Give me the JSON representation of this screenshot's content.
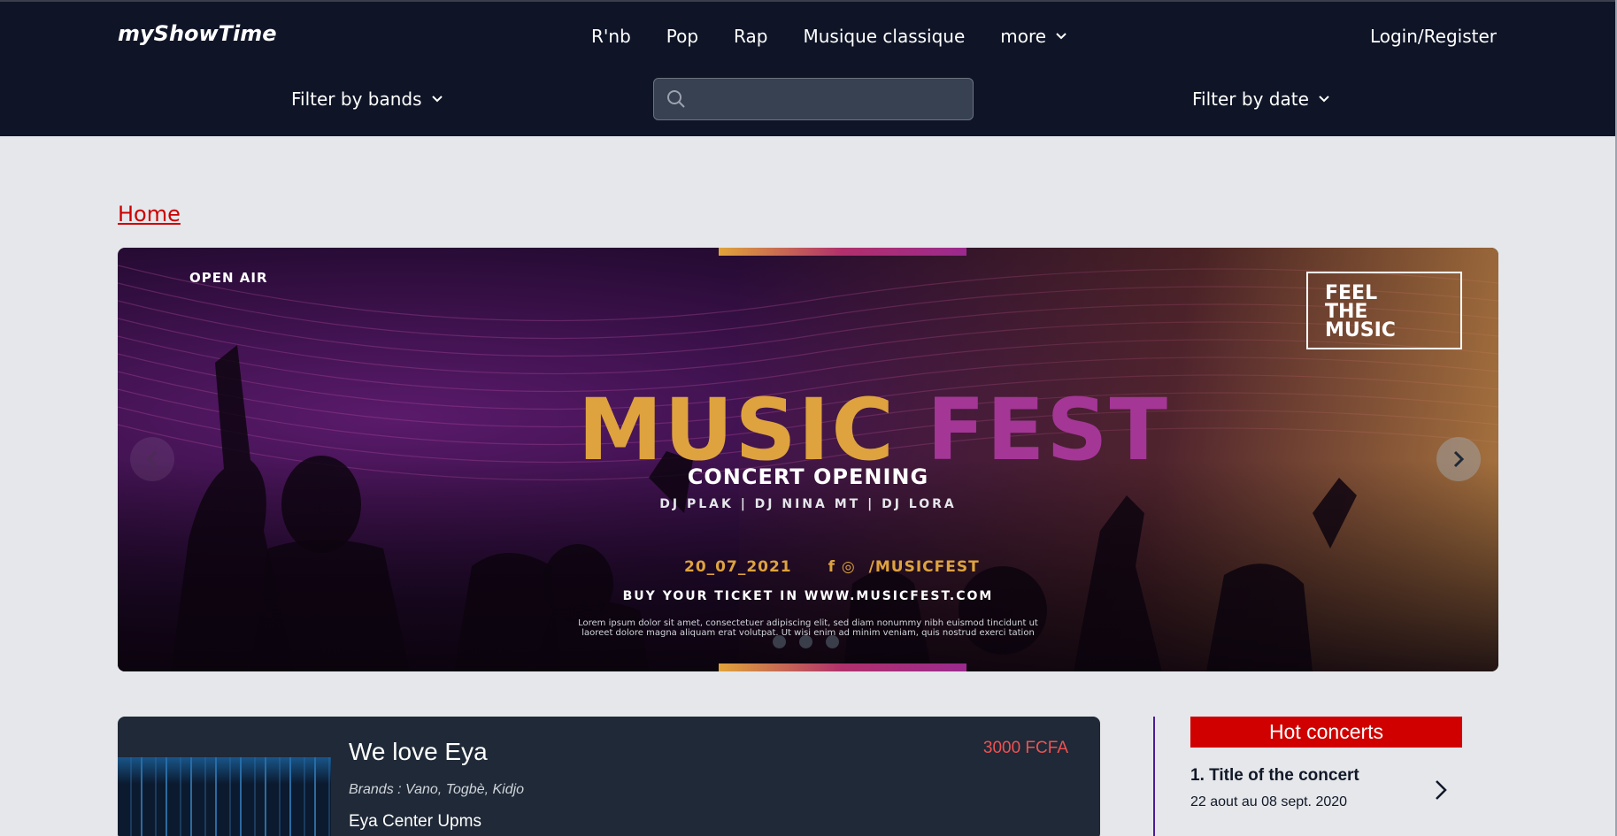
{
  "header": {
    "logo": "myShowTime",
    "nav": [
      {
        "label": "R'nb"
      },
      {
        "label": "Pop"
      },
      {
        "label": "Rap"
      },
      {
        "label": "Musique classique"
      },
      {
        "label": "more"
      }
    ],
    "login_label": "Login/Register",
    "filter_bands_label": "Filter by bands",
    "filter_date_label": "Filter by date",
    "search": {
      "placeholder": "",
      "value": ""
    }
  },
  "breadcrumb": {
    "home": "Home"
  },
  "carousel": {
    "open_air": "OPEN AIR",
    "feel_the_music": [
      "FEEL",
      "THE",
      "MUSIC"
    ],
    "title_word1": "MUSIC",
    "title_word2": "FEST",
    "subtitle": "CONCERT OPENING",
    "djs": "DJ PLAK  |  DJ NINA MT   |   DJ LORA",
    "date": "20_07_2021",
    "social_handle": "/MUSICFEST",
    "buy_text": "BUY YOUR TICKET IN WWW.MUSICFEST.COM",
    "lorem_line1": "Lorem ipsum dolor sit amet, consectetuer adipiscing elit, sed diam nonummy nibh euismod tincidunt ut",
    "lorem_line2": "laoreet dolore magna aliquam erat volutpat. Ut wisi enim ad minim veniam, quis nostrud exerci tation",
    "slide_count": 3,
    "active_slide": 1
  },
  "concert_card": {
    "title": "We love Eya",
    "brands": "Brands : Vano, Togbè, Kidjo",
    "venue": "Eya Center Upms",
    "price": "3000 FCFA"
  },
  "hot_concerts": {
    "header": "Hot concerts",
    "items": [
      {
        "title": "1. Title of the concert",
        "dates": "22 aout au 08 sept. 2020"
      }
    ]
  },
  "colors": {
    "header_bg": "#0f1527",
    "page_bg": "#e5e7eb",
    "accent_red": "#d00000",
    "price_red": "#f05252",
    "card_bg": "#1f2937"
  }
}
